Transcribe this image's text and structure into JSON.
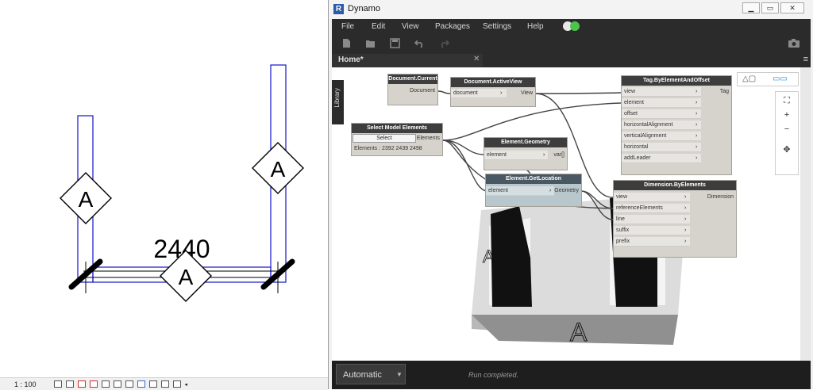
{
  "revit": {
    "dimension_text": "2440",
    "tag_letter": "A",
    "scale": "1 : 100"
  },
  "dynamo": {
    "title": "Dynamo",
    "menu": [
      "File",
      "Edit",
      "View",
      "Packages",
      "Settings",
      "Help"
    ],
    "tab": {
      "label": "Home*",
      "close": "✕"
    },
    "library_label": "Library",
    "run_mode": "Automatic",
    "run_status": "Run completed.",
    "preview_letter": "A",
    "nodes": {
      "document_current": {
        "title": "Document.Current",
        "output": "Document"
      },
      "document_active_view": {
        "title": "Document.ActiveView",
        "input": "document",
        "output": "View"
      },
      "select_model_elements": {
        "title": "Select Model Elements",
        "button": "Select",
        "output": "Elements",
        "footer": "Elements : 2392 2439 2498"
      },
      "element_geometry": {
        "title": "Element.Geometry",
        "input": "element",
        "output": "var[]"
      },
      "element_get_location": {
        "title": "Element.GetLocation",
        "input": "element",
        "output": "Geometry"
      },
      "tag_by_element_and_offset": {
        "title": "Tag.ByElementAndOffset",
        "inputs": [
          "view",
          "element",
          "offset",
          "horizontalAlignment",
          "verticalAlignment",
          "horizontal",
          "addLeader"
        ],
        "output": "Tag"
      },
      "dimension_by_elements": {
        "title": "Dimension.ByElements",
        "inputs": [
          "view",
          "referenceElements",
          "line",
          "suffix",
          "prefix"
        ],
        "output": "Dimension"
      }
    }
  },
  "colors": {
    "wall_outline": "#1414c8",
    "dark_ui": "#2b2b2b",
    "node_body": "#d6d3cd",
    "status_green": "#4cc44c"
  }
}
